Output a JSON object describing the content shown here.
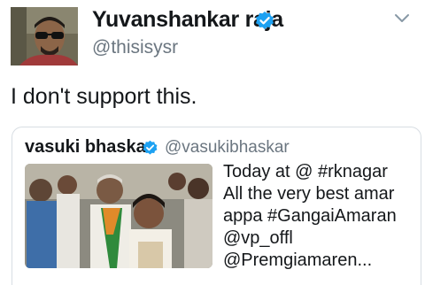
{
  "tweet": {
    "author_name": "Yuvanshankar raja",
    "author_handle": "@thisisysr",
    "text": "I don't support this.",
    "verified_icon": "verified-badge-icon",
    "menu_icon": "chevron-down-icon"
  },
  "quoted_tweet": {
    "author_name": "vasuki bhaskar",
    "author_handle": "@vasukibhaskar",
    "text_lines": [
      "Today at @ #rknagar",
      "All the very best amar",
      "appa #GangaiAmaran",
      "@vp_offl",
      "@Premgiamaren..."
    ]
  },
  "colors": {
    "verified_blue": "#1da1f2",
    "secondary_text": "#6b7680",
    "border": "#d8dee3"
  }
}
